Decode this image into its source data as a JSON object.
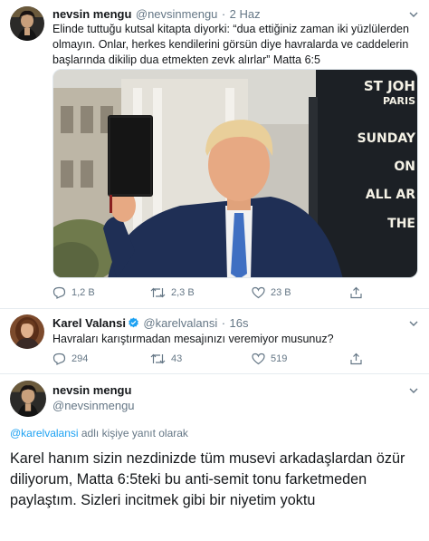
{
  "tweet1": {
    "name": "nevsin mengu",
    "handle": "@nevsinmengu",
    "sep": "·",
    "time": "2 Haz",
    "text": "Elinde tuttuğu kutsal kitapta diyorki: “dua ettiğiniz zaman iki yüzlülerden olmayın. Onlar, herkes kendilerini görsün diye havralarda ve caddelerin başlarında dikilip dua etmekten zevk alırlar” Matta 6:5",
    "replies": "1,2 B",
    "retweets": "2,3 B",
    "likes": "23 B",
    "photo_sign_lines": [
      "ST JOH",
      "PARIS",
      "SUNDAY",
      "ON",
      "ALL AR",
      "THE"
    ]
  },
  "tweet2": {
    "name": "Karel Valansi",
    "handle": "@karelvalansi",
    "sep": "·",
    "time": "16s",
    "text": "Havraları karıştırmadan mesajınızı veremiyor musunuz?",
    "replies": "294",
    "retweets": "43",
    "likes": "519"
  },
  "tweet3": {
    "name": "nevsin mengu",
    "handle": "@nevsinmengu",
    "reply_to_handle": "@karelvalansi",
    "reply_to_suffix": " adlı kişiye yanıt olarak",
    "text": "Karel hanım sizin nezdinizde tüm musevi arkadaşlardan özür diliyorum, Matta 6:5teki bu anti-semit tonu farketmeden paylaştım. Sizleri incitmek gibi bir niyetim yoktu"
  },
  "colors": {
    "text": "#14171a",
    "muted": "#657786",
    "link": "#1da1f2",
    "divider": "#e6ecf0"
  }
}
